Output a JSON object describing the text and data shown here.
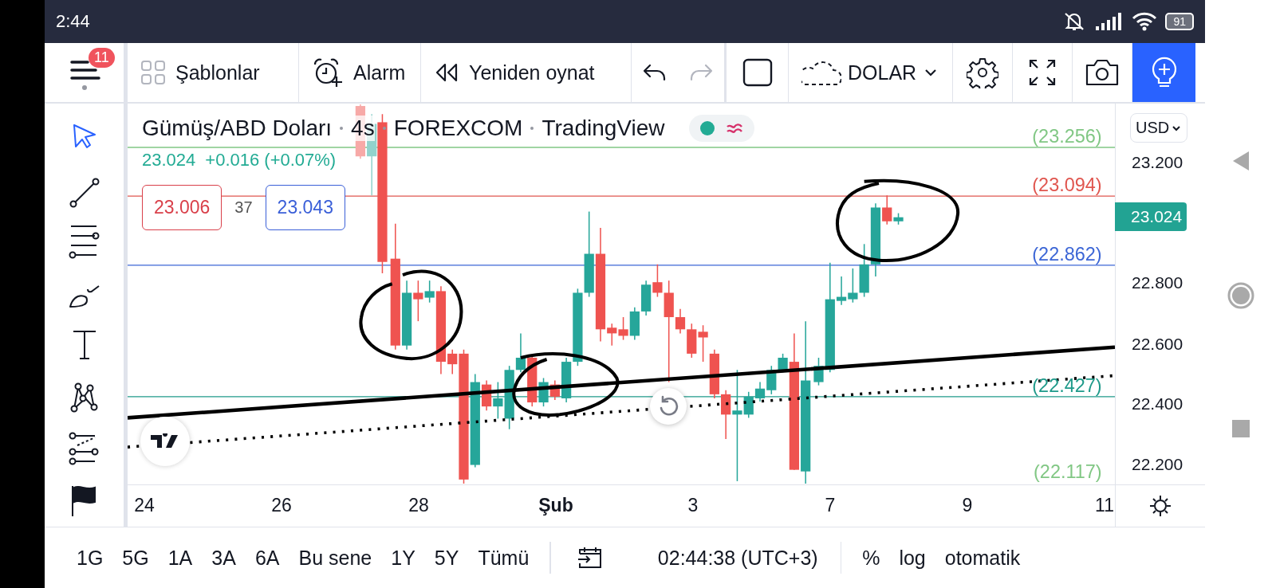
{
  "status_bar": {
    "time": "2:44",
    "battery": "91"
  },
  "toolbar": {
    "notification_count": "11",
    "items": [
      {
        "kind": "templates",
        "label": "Şablonlar"
      },
      {
        "kind": "alarm",
        "label": "Alarm"
      },
      {
        "kind": "replay",
        "label": "Yeniden oynat"
      }
    ],
    "history": [
      {
        "kind": "undo",
        "disabled": false
      },
      {
        "kind": "redo",
        "disabled": true
      }
    ],
    "unit": "DOLAR",
    "ideas_selected": true
  },
  "drawing_tools": [
    {
      "kind": "cursor",
      "selected": true
    },
    {
      "kind": "trend-line",
      "selected": false
    },
    {
      "kind": "fib",
      "selected": false
    },
    {
      "kind": "brush",
      "selected": false
    },
    {
      "kind": "text",
      "selected": false
    },
    {
      "kind": "pattern",
      "selected": false
    },
    {
      "kind": "forecast",
      "selected": false
    },
    {
      "kind": "flag",
      "selected": false
    }
  ],
  "chart": {
    "legend": [
      "Gümüş/ABD Doları",
      "4s",
      "FOREXCOM",
      "TradingView"
    ],
    "price": "23.024",
    "change": "+0.016 (+0.07%)",
    "sell": "23.006",
    "spread": "37",
    "buy": "23.043",
    "levels": [
      {
        "label": "(23.256)",
        "color": "#81c784"
      },
      {
        "label": "(23.094)",
        "color": "#e0564f"
      },
      {
        "label": "(22.862)",
        "color": "#3c66d6"
      },
      {
        "label": "(22.427)",
        "color": "#1f9a8a"
      },
      {
        "label": "(22.117)",
        "color": "#81c784"
      }
    ]
  },
  "price_axis": {
    "currency": "USD",
    "ticks": [
      "23.200",
      "22.800",
      "22.600",
      "22.400",
      "22.200"
    ],
    "last_price": "23.024"
  },
  "time_axis": [
    {
      "label": "24",
      "kind": "day"
    },
    {
      "label": "26",
      "kind": "day"
    },
    {
      "label": "28",
      "kind": "day"
    },
    {
      "label": "Şub",
      "kind": "month"
    },
    {
      "label": "3",
      "kind": "day"
    },
    {
      "label": "7",
      "kind": "day"
    },
    {
      "label": "9",
      "kind": "day"
    },
    {
      "label": "11",
      "kind": "day"
    }
  ],
  "bottom_bar": {
    "ranges": [
      "1G",
      "5G",
      "1A",
      "3A",
      "6A",
      "Bu sene",
      "1Y",
      "5Y",
      "Tümü"
    ],
    "time": "02:44:38 (UTC+3)",
    "percent": "%",
    "log": "log",
    "auto": "otomatik"
  }
}
